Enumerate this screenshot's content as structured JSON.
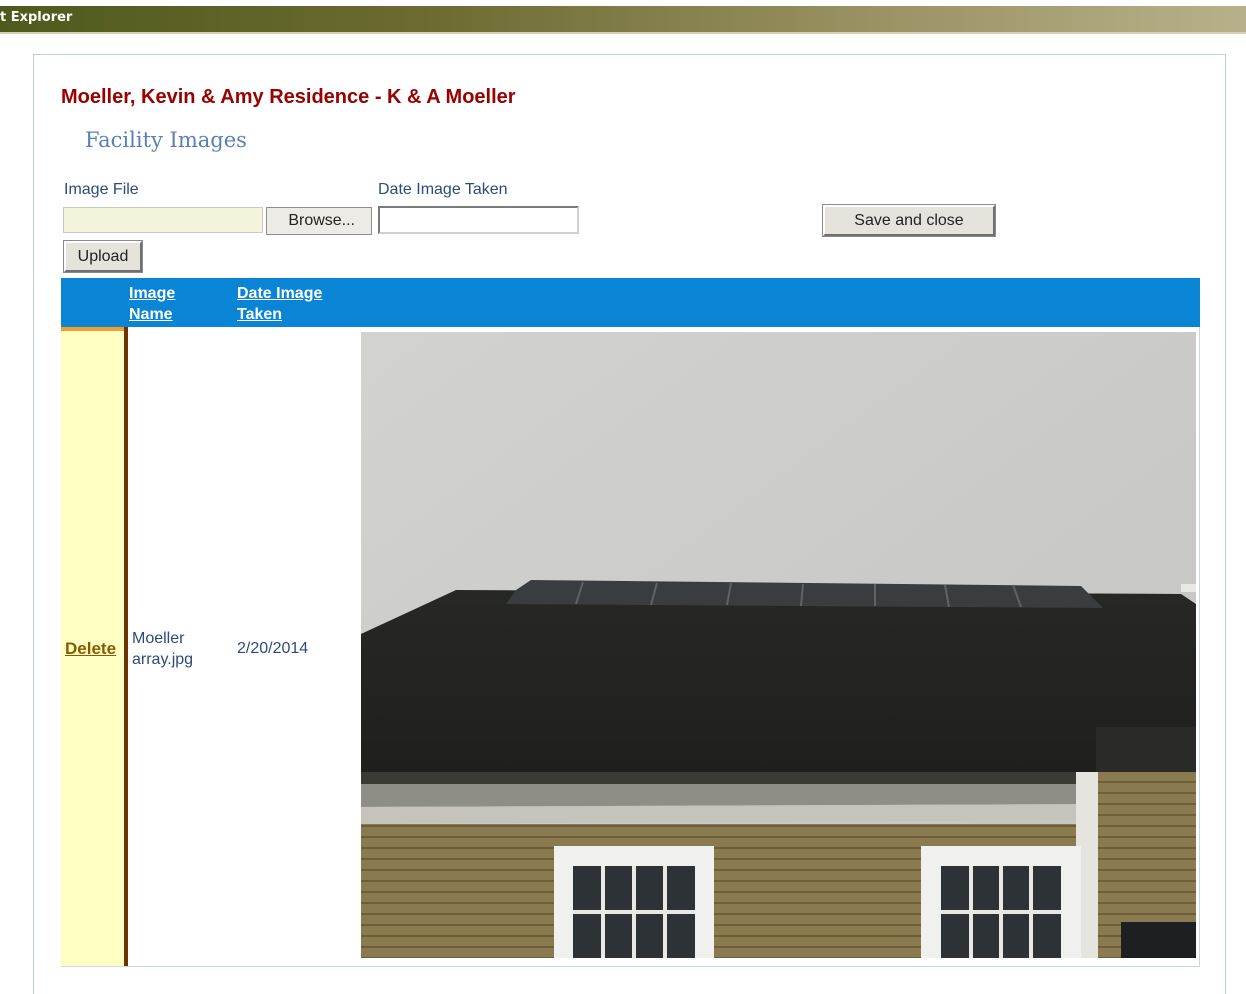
{
  "window": {
    "title": "t Explorer"
  },
  "header": {
    "residence_name": "Moeller, Kevin & Amy Residence - K & A Moeller",
    "section_title": "Facility Images"
  },
  "form": {
    "image_file_label": "Image File",
    "date_label": "Date Image Taken",
    "image_file_value": "",
    "date_value": "",
    "browse_label": "Browse...",
    "save_close_label": "Save and close",
    "upload_label": "Upload"
  },
  "grid": {
    "columns": [
      "Image Name",
      "Date Image Taken"
    ],
    "column_lines": [
      "Image\nName",
      "Date Image\nTaken"
    ],
    "rows": [
      {
        "delete_label": "Delete",
        "image_name": "Moeller array.jpg",
        "image_name_lines": "Moeller\narray.jpg",
        "date_taken": "2/20/2014",
        "photo_subject": "house-roof-solar-array-photo"
      }
    ]
  },
  "colors": {
    "header_blue": "#0a85d6",
    "residence_red": "#990000",
    "delete_cell_bg": "#ffffc4",
    "label_blue": "#2d4a7a"
  }
}
